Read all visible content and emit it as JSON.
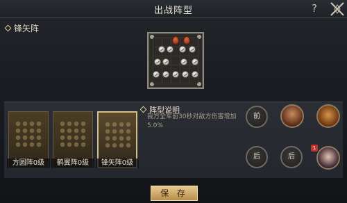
{
  "header": {
    "title": "出战阵型",
    "help_glyph": "?"
  },
  "section": {
    "formation_name": "锋矢阵"
  },
  "description": {
    "title": "阵型说明",
    "text": "我方全军前30秒对敌方伤害增加5.0%"
  },
  "formations": [
    {
      "label": "方圆阵0级",
      "selected": false
    },
    {
      "label": "鹤翼阵0级",
      "selected": false
    },
    {
      "label": "锋矢阵0级",
      "selected": true
    }
  ],
  "slots": {
    "front_label": "前",
    "back_label": "后"
  },
  "hero_badge": "1",
  "save_label": "保 存",
  "colors": {
    "accent": "#d6bf86",
    "save_bg": "#d8b874",
    "marker": "#c24a2a"
  }
}
